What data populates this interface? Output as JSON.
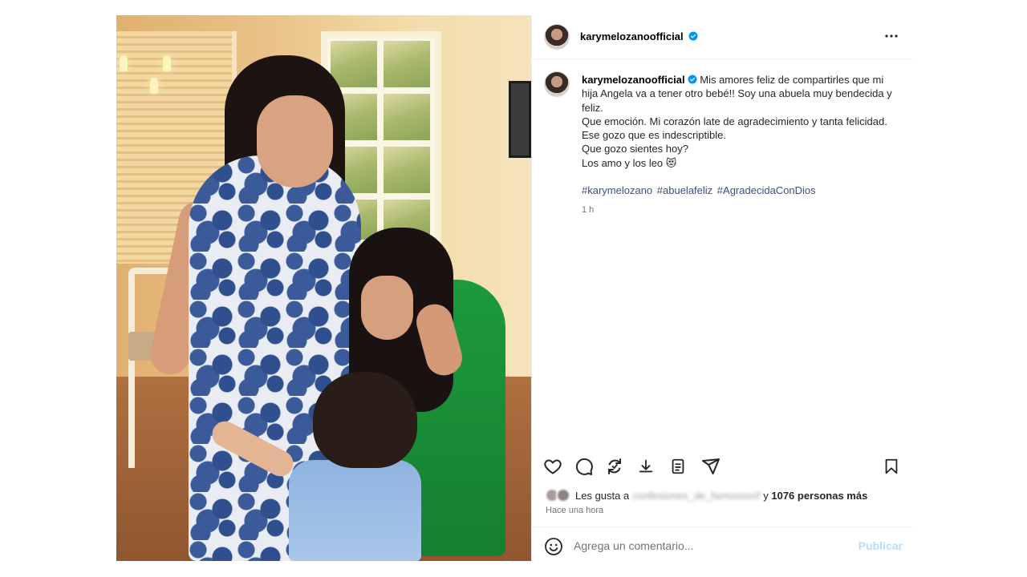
{
  "post": {
    "author": {
      "username": "karymelozanoofficial",
      "verified": true
    },
    "caption": {
      "lines": [
        "Mis amores feliz de compartirles que mi hija Angela va a tener otro bebé!! Soy una abuela muy bendecida y feliz.",
        "Que emoción. Mi corazón late de agradecimiento y tanta felicidad. Ese gozo que es indescriptible.",
        "Que gozo sientes hoy?",
        "Los amo y los leo 😻"
      ],
      "hashtags": [
        "#karymelozano",
        "#abuelafeliz",
        "#AgradecidaConDios"
      ],
      "time": "1 h"
    },
    "likes": {
      "prefix": "Les gusta a",
      "blurred_user": "confesiones_de_famosooof",
      "connector": "y",
      "count_text": "1076 personas más"
    },
    "posted_ago": "Hace una hora",
    "comment": {
      "placeholder": "Agrega un comentario...",
      "publish_label": "Publicar"
    }
  },
  "colors": {
    "verified": "#0095f6",
    "hashtag": "#385185",
    "publish_disabled": "#b2dffc",
    "secondary_text": "#737373"
  },
  "icons": {
    "more": "more-horizontal-icon",
    "like": "heart-icon",
    "comment": "comment-icon",
    "repost": "repost-icon",
    "download": "download-icon",
    "save_to_collection": "copy-icon",
    "share": "share-icon",
    "bookmark": "bookmark-icon",
    "emoji": "emoji-icon"
  }
}
